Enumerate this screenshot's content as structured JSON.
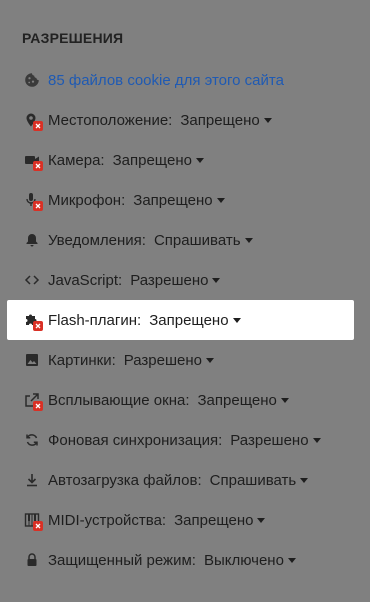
{
  "section": {
    "title": "РАЗРЕШЕНИЯ"
  },
  "cookies": {
    "label": "85 файлов cookie для этого сайта",
    "icon": "cookie-icon",
    "color": "#1f5ab3"
  },
  "permissions": [
    {
      "id": "location",
      "icon": "location-blocked-icon",
      "label": "Местоположение:",
      "value": "Запрещено",
      "blocked": true
    },
    {
      "id": "camera",
      "icon": "camera-blocked-icon",
      "label": "Камера:",
      "value": "Запрещено",
      "blocked": true
    },
    {
      "id": "microphone",
      "icon": "microphone-blocked-icon",
      "label": "Микрофон:",
      "value": "Запрещено",
      "blocked": true
    },
    {
      "id": "notifications",
      "icon": "bell-icon",
      "label": "Уведомления:",
      "value": "Спрашивать",
      "blocked": false
    },
    {
      "id": "javascript",
      "icon": "code-icon",
      "label": "JavaScript:",
      "value": "Разрешено",
      "blocked": false
    },
    {
      "id": "flash",
      "icon": "puzzle-blocked-icon",
      "label": "Flash-плагин:",
      "value": "Запрещено",
      "blocked": true,
      "highlighted": true
    },
    {
      "id": "images",
      "icon": "image-icon",
      "label": "Картинки:",
      "value": "Разрешено",
      "blocked": false
    },
    {
      "id": "popups",
      "icon": "popup-blocked-icon",
      "label": "Всплывающие окна:",
      "value": "Запрещено",
      "blocked": true
    },
    {
      "id": "background-sync",
      "icon": "sync-icon",
      "label": "Фоновая синхронизация:",
      "value": "Разрешено",
      "blocked": false
    },
    {
      "id": "downloads",
      "icon": "download-icon",
      "label": "Автозагрузка файлов:",
      "value": "Спрашивать",
      "blocked": false
    },
    {
      "id": "midi",
      "icon": "midi-blocked-icon",
      "label": "MIDI-устройства:",
      "value": "Запрещено",
      "blocked": true
    },
    {
      "id": "protected",
      "icon": "lock-icon",
      "label": "Защищенный режим:",
      "value": "Выключено",
      "blocked": false
    }
  ],
  "colors": {
    "background": "#808080",
    "highlight": "#ffffff",
    "blocked_badge": "#d93025"
  }
}
